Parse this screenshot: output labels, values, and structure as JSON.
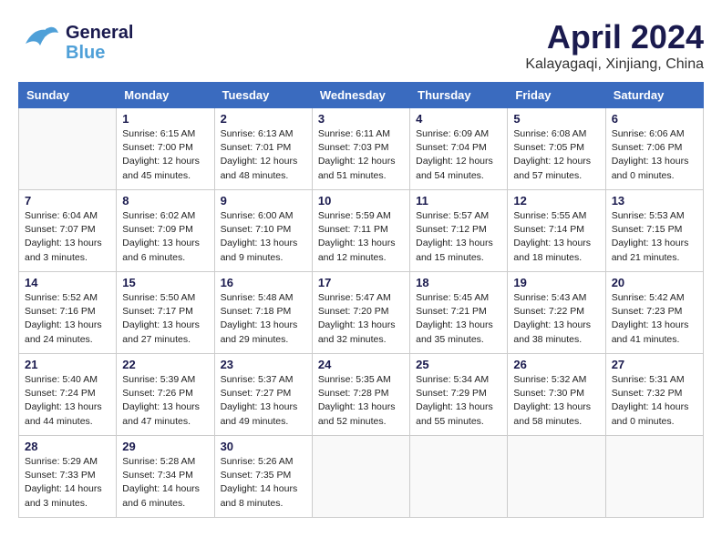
{
  "header": {
    "logo_line1": "General",
    "logo_line2": "Blue",
    "title": "April 2024",
    "location": "Kalayagaqi, Xinjiang, China"
  },
  "weekdays": [
    "Sunday",
    "Monday",
    "Tuesday",
    "Wednesday",
    "Thursday",
    "Friday",
    "Saturday"
  ],
  "weeks": [
    [
      {
        "day": "",
        "info": ""
      },
      {
        "day": "1",
        "info": "Sunrise: 6:15 AM\nSunset: 7:00 PM\nDaylight: 12 hours\nand 45 minutes."
      },
      {
        "day": "2",
        "info": "Sunrise: 6:13 AM\nSunset: 7:01 PM\nDaylight: 12 hours\nand 48 minutes."
      },
      {
        "day": "3",
        "info": "Sunrise: 6:11 AM\nSunset: 7:03 PM\nDaylight: 12 hours\nand 51 minutes."
      },
      {
        "day": "4",
        "info": "Sunrise: 6:09 AM\nSunset: 7:04 PM\nDaylight: 12 hours\nand 54 minutes."
      },
      {
        "day": "5",
        "info": "Sunrise: 6:08 AM\nSunset: 7:05 PM\nDaylight: 12 hours\nand 57 minutes."
      },
      {
        "day": "6",
        "info": "Sunrise: 6:06 AM\nSunset: 7:06 PM\nDaylight: 13 hours\nand 0 minutes."
      }
    ],
    [
      {
        "day": "7",
        "info": "Sunrise: 6:04 AM\nSunset: 7:07 PM\nDaylight: 13 hours\nand 3 minutes."
      },
      {
        "day": "8",
        "info": "Sunrise: 6:02 AM\nSunset: 7:09 PM\nDaylight: 13 hours\nand 6 minutes."
      },
      {
        "day": "9",
        "info": "Sunrise: 6:00 AM\nSunset: 7:10 PM\nDaylight: 13 hours\nand 9 minutes."
      },
      {
        "day": "10",
        "info": "Sunrise: 5:59 AM\nSunset: 7:11 PM\nDaylight: 13 hours\nand 12 minutes."
      },
      {
        "day": "11",
        "info": "Sunrise: 5:57 AM\nSunset: 7:12 PM\nDaylight: 13 hours\nand 15 minutes."
      },
      {
        "day": "12",
        "info": "Sunrise: 5:55 AM\nSunset: 7:14 PM\nDaylight: 13 hours\nand 18 minutes."
      },
      {
        "day": "13",
        "info": "Sunrise: 5:53 AM\nSunset: 7:15 PM\nDaylight: 13 hours\nand 21 minutes."
      }
    ],
    [
      {
        "day": "14",
        "info": "Sunrise: 5:52 AM\nSunset: 7:16 PM\nDaylight: 13 hours\nand 24 minutes."
      },
      {
        "day": "15",
        "info": "Sunrise: 5:50 AM\nSunset: 7:17 PM\nDaylight: 13 hours\nand 27 minutes."
      },
      {
        "day": "16",
        "info": "Sunrise: 5:48 AM\nSunset: 7:18 PM\nDaylight: 13 hours\nand 29 minutes."
      },
      {
        "day": "17",
        "info": "Sunrise: 5:47 AM\nSunset: 7:20 PM\nDaylight: 13 hours\nand 32 minutes."
      },
      {
        "day": "18",
        "info": "Sunrise: 5:45 AM\nSunset: 7:21 PM\nDaylight: 13 hours\nand 35 minutes."
      },
      {
        "day": "19",
        "info": "Sunrise: 5:43 AM\nSunset: 7:22 PM\nDaylight: 13 hours\nand 38 minutes."
      },
      {
        "day": "20",
        "info": "Sunrise: 5:42 AM\nSunset: 7:23 PM\nDaylight: 13 hours\nand 41 minutes."
      }
    ],
    [
      {
        "day": "21",
        "info": "Sunrise: 5:40 AM\nSunset: 7:24 PM\nDaylight: 13 hours\nand 44 minutes."
      },
      {
        "day": "22",
        "info": "Sunrise: 5:39 AM\nSunset: 7:26 PM\nDaylight: 13 hours\nand 47 minutes."
      },
      {
        "day": "23",
        "info": "Sunrise: 5:37 AM\nSunset: 7:27 PM\nDaylight: 13 hours\nand 49 minutes."
      },
      {
        "day": "24",
        "info": "Sunrise: 5:35 AM\nSunset: 7:28 PM\nDaylight: 13 hours\nand 52 minutes."
      },
      {
        "day": "25",
        "info": "Sunrise: 5:34 AM\nSunset: 7:29 PM\nDaylight: 13 hours\nand 55 minutes."
      },
      {
        "day": "26",
        "info": "Sunrise: 5:32 AM\nSunset: 7:30 PM\nDaylight: 13 hours\nand 58 minutes."
      },
      {
        "day": "27",
        "info": "Sunrise: 5:31 AM\nSunset: 7:32 PM\nDaylight: 14 hours\nand 0 minutes."
      }
    ],
    [
      {
        "day": "28",
        "info": "Sunrise: 5:29 AM\nSunset: 7:33 PM\nDaylight: 14 hours\nand 3 minutes."
      },
      {
        "day": "29",
        "info": "Sunrise: 5:28 AM\nSunset: 7:34 PM\nDaylight: 14 hours\nand 6 minutes."
      },
      {
        "day": "30",
        "info": "Sunrise: 5:26 AM\nSunset: 7:35 PM\nDaylight: 14 hours\nand 8 minutes."
      },
      {
        "day": "",
        "info": ""
      },
      {
        "day": "",
        "info": ""
      },
      {
        "day": "",
        "info": ""
      },
      {
        "day": "",
        "info": ""
      }
    ]
  ]
}
